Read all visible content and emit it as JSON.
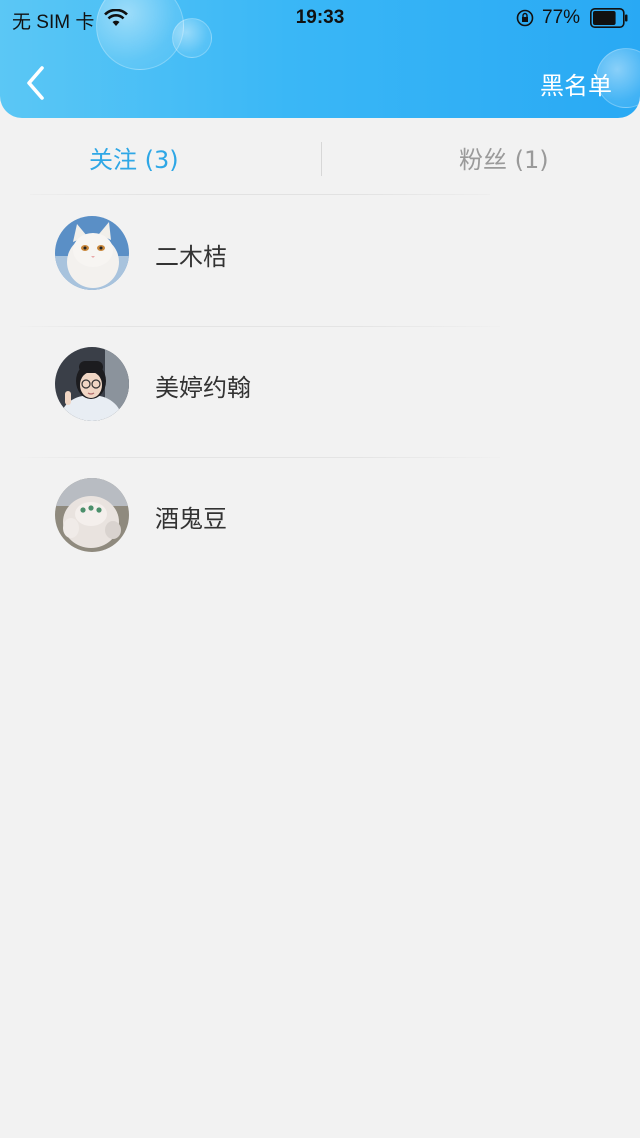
{
  "status_bar": {
    "carrier": "无 SIM 卡",
    "time": "19:33",
    "battery_percent": "77%",
    "battery_level": 0.77
  },
  "header": {
    "back_icon": "chevron-left-icon",
    "blacklist_label": "黑名单",
    "gradient_colors": [
      "#5bc7f5",
      "#29a9f4"
    ]
  },
  "tabs": {
    "following_label": "关注 (3)",
    "fans_label": "粉丝 (1)",
    "active_color": "#2ea7e6",
    "inactive_color": "#9a9a9a"
  },
  "following_list": [
    {
      "name": "二木桔",
      "avatar": "white-cat-avatar"
    },
    {
      "name": "美婷约翰",
      "avatar": "girl-with-glasses-avatar"
    },
    {
      "name": "酒鬼豆",
      "avatar": "fluffy-dog-avatar"
    }
  ]
}
